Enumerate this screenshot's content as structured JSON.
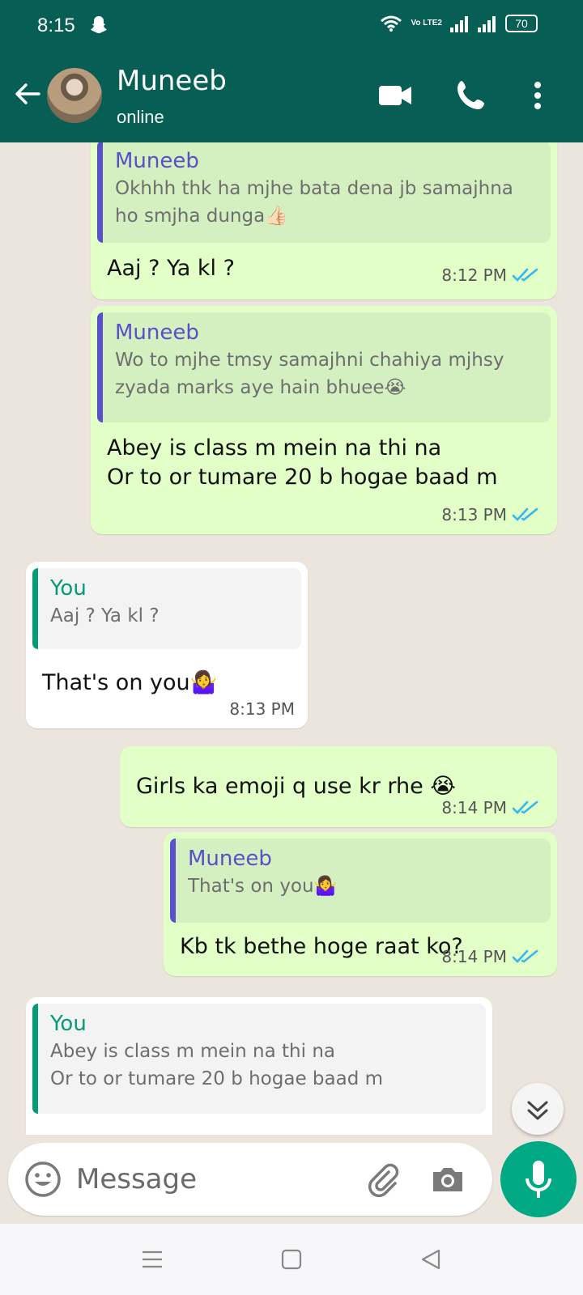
{
  "status_bar": {
    "time": "8:15",
    "network": "Vo LTE2",
    "battery": "70"
  },
  "header": {
    "name": "Muneeb",
    "status": "online"
  },
  "messages": [
    {
      "quote_author": "Muneeb",
      "quote_text": "Okhhh thk ha mjhe bata dena jb samajhna ho smjha dunga👍🏻",
      "text": "Aaj ? Ya kl ?",
      "time": "8:12 PM"
    },
    {
      "quote_author": "Muneeb",
      "quote_text": "Wo to mjhe tmsy samajhni chahiya mjhsy zyada marks aye hain bhuee😭",
      "text": "Abey is class m mein na thi na\nOr to or tumare 20 b hogae baad m",
      "time": "8:13 PM"
    },
    {
      "quote_author": "You",
      "quote_text": "Aaj ? Ya kl ?",
      "text": "That's on you🤷‍♀️",
      "time": "8:13 PM"
    },
    {
      "text": "Girls ka emoji q use kr rhe 😭",
      "time": "8:14 PM"
    },
    {
      "quote_author": "Muneeb",
      "quote_text": "That's on you🤷‍♀️",
      "text": "Kb tk bethe hoge raat ko?",
      "time": "8:14 PM"
    },
    {
      "quote_author": "You",
      "quote_text": "Abey is class m mein na thi na\nOr to or tumare 20 b hogae baad m",
      "text": "",
      "time": ""
    }
  ],
  "composer": {
    "placeholder": "Message"
  },
  "colors": {
    "header": "#075e54",
    "outgoing": "#e2ffc7",
    "incoming": "#ffffff",
    "accent": "#00a884",
    "tick": "#34b7f1"
  },
  "icons": [
    "back-arrow-icon",
    "video-call-icon",
    "phone-icon",
    "more-icon",
    "emoji-icon",
    "attach-icon",
    "camera-icon",
    "mic-icon",
    "scroll-down-icon",
    "read-ticks-icon"
  ]
}
